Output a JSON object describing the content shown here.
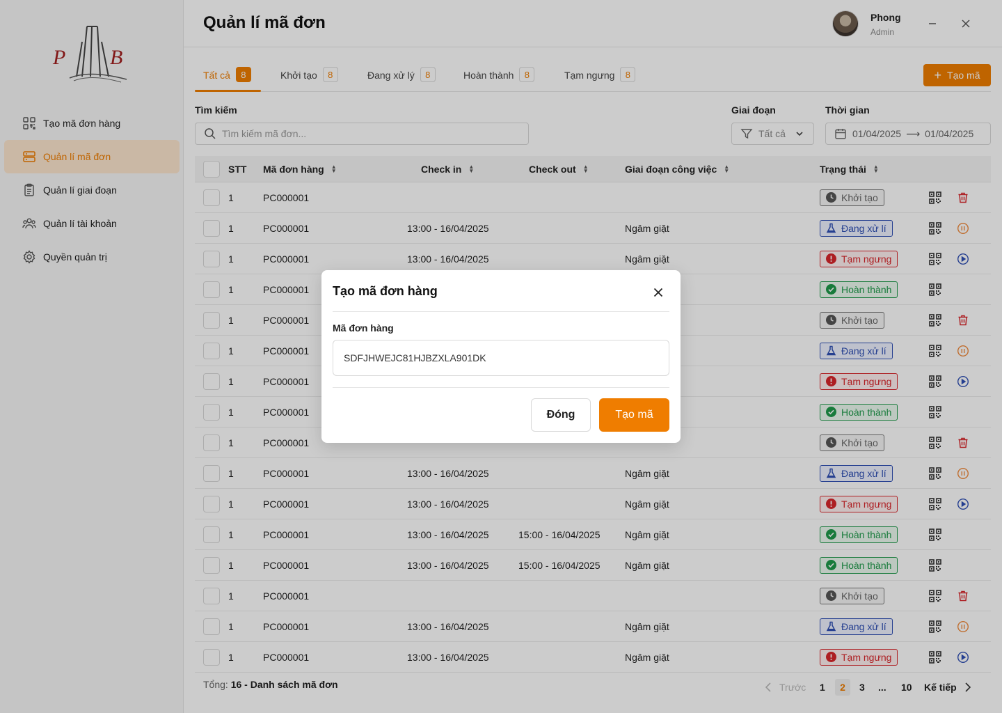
{
  "sidebar": {
    "items": [
      {
        "label": "Tạo mã đơn hàng",
        "icon": "qr-scan-icon"
      },
      {
        "label": "Quản lí mã đơn",
        "icon": "server-icon"
      },
      {
        "label": "Quản lí giai đoạn",
        "icon": "clipboard-icon"
      },
      {
        "label": "Quản lí tài khoản",
        "icon": "users-icon"
      },
      {
        "label": "Quyền quản trị",
        "icon": "gear-icon"
      }
    ],
    "active_index": 1
  },
  "header": {
    "title": "Quản lí mã đơn",
    "user_name": "Phong",
    "user_role": "Admin"
  },
  "tabs": [
    {
      "label": "Tất cả",
      "count": "8"
    },
    {
      "label": "Khởi tạo",
      "count": "8"
    },
    {
      "label": "Đang xử lý",
      "count": "8"
    },
    {
      "label": "Hoàn thành",
      "count": "8"
    },
    {
      "label": "Tạm ngưng",
      "count": "8"
    }
  ],
  "create_button": "Tạo mã",
  "filters": {
    "search_label": "Tìm kiếm",
    "search_placeholder": "Tìm kiếm mã đơn...",
    "stage_label": "Giai đoạn",
    "stage_value": "Tất cả",
    "time_label": "Thời gian",
    "date_from": "01/04/2025",
    "date_to": "01/04/2025"
  },
  "table": {
    "columns": [
      "STT",
      "Mã đơn hàng",
      "Check in",
      "Check out",
      "Giai đoạn công việc",
      "Trạng thái"
    ],
    "rows": [
      {
        "stt": "1",
        "code": "PC000001",
        "checkin": "",
        "checkout": "",
        "stage": "",
        "status": "Khởi tạo",
        "kind": "init",
        "action": "delete"
      },
      {
        "stt": "1",
        "code": "PC000001",
        "checkin": "13:00 - 16/04/2025",
        "checkout": "",
        "stage": "Ngâm giặt",
        "status": "Đang xử lí",
        "kind": "proc",
        "action": "pause"
      },
      {
        "stt": "1",
        "code": "PC000001",
        "checkin": "13:00 - 16/04/2025",
        "checkout": "",
        "stage": "Ngâm giặt",
        "status": "Tạm ngưng",
        "kind": "pause",
        "action": "play"
      },
      {
        "stt": "1",
        "code": "PC000001",
        "checkin": "",
        "checkout": "",
        "stage": "",
        "status": "Hoàn thành",
        "kind": "done",
        "action": ""
      },
      {
        "stt": "1",
        "code": "PC000001",
        "checkin": "",
        "checkout": "",
        "stage": "",
        "status": "Khởi tạo",
        "kind": "init",
        "action": "delete"
      },
      {
        "stt": "1",
        "code": "PC000001",
        "checkin": "",
        "checkout": "",
        "stage": "",
        "status": "Đang xử lí",
        "kind": "proc",
        "action": "pause"
      },
      {
        "stt": "1",
        "code": "PC000001",
        "checkin": "",
        "checkout": "",
        "stage": "",
        "status": "Tạm ngưng",
        "kind": "pause",
        "action": "play"
      },
      {
        "stt": "1",
        "code": "PC000001",
        "checkin": "",
        "checkout": "",
        "stage": "",
        "status": "Hoàn thành",
        "kind": "done",
        "action": ""
      },
      {
        "stt": "1",
        "code": "PC000001",
        "checkin": "",
        "checkout": "",
        "stage": "",
        "status": "Khởi tạo",
        "kind": "init",
        "action": "delete"
      },
      {
        "stt": "1",
        "code": "PC000001",
        "checkin": "13:00 - 16/04/2025",
        "checkout": "",
        "stage": "Ngâm giặt",
        "status": "Đang xử lí",
        "kind": "proc",
        "action": "pause"
      },
      {
        "stt": "1",
        "code": "PC000001",
        "checkin": "13:00 - 16/04/2025",
        "checkout": "",
        "stage": "Ngâm giặt",
        "status": "Tạm ngưng",
        "kind": "pause",
        "action": "play"
      },
      {
        "stt": "1",
        "code": "PC000001",
        "checkin": "13:00 - 16/04/2025",
        "checkout": "15:00 - 16/04/2025",
        "stage": "Ngâm giặt",
        "status": "Hoàn thành",
        "kind": "done",
        "action": ""
      },
      {
        "stt": "1",
        "code": "PC000001",
        "checkin": "13:00 - 16/04/2025",
        "checkout": "15:00 - 16/04/2025",
        "stage": "Ngâm giặt",
        "status": "Hoàn thành",
        "kind": "done",
        "action": ""
      },
      {
        "stt": "1",
        "code": "PC000001",
        "checkin": "",
        "checkout": "",
        "stage": "",
        "status": "Khởi tạo",
        "kind": "init",
        "action": "delete"
      },
      {
        "stt": "1",
        "code": "PC000001",
        "checkin": "13:00 - 16/04/2025",
        "checkout": "",
        "stage": "Ngâm giặt",
        "status": "Đang xử lí",
        "kind": "proc",
        "action": "pause"
      },
      {
        "stt": "1",
        "code": "PC000001",
        "checkin": "13:00 - 16/04/2025",
        "checkout": "",
        "stage": "Ngâm giặt",
        "status": "Tạm ngưng",
        "kind": "pause",
        "action": "play"
      }
    ]
  },
  "footer": {
    "total_prefix": "Tổng:",
    "total_text": "16 - Danh sách mã đơn"
  },
  "pagination": {
    "prev": "Trước",
    "next": "Kế tiếp",
    "pages": [
      "1",
      "2",
      "3",
      "...",
      "10"
    ],
    "current": "2"
  },
  "modal": {
    "title": "Tạo mã đơn hàng",
    "field_label": "Mã đơn hàng",
    "field_value": "SDFJHWEJC81HJBZXLA901DK",
    "close_label": "Đóng",
    "submit_label": "Tạo mã"
  },
  "colors": {
    "accent": "#ef7d00",
    "init": "#555555",
    "processing": "#2f4fb5",
    "paused": "#d9262b",
    "done": "#1e9a4a"
  }
}
